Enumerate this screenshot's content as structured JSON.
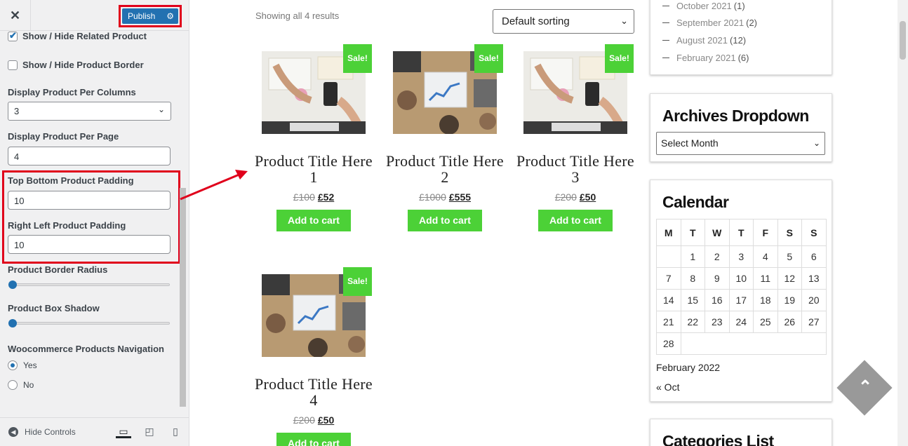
{
  "panel": {
    "close_label": "✕",
    "publish_label": "Publish",
    "show_related_label": "Show / Hide Related Product",
    "show_border_label": "Show / Hide Product Border",
    "per_columns_label": "Display Product Per Columns",
    "per_columns_value": "3",
    "per_page_label": "Display Product Per Page",
    "per_page_value": "4",
    "top_bottom_label": "Top Bottom Product Padding",
    "top_bottom_value": "10",
    "right_left_label": "Right Left Product Padding",
    "right_left_value": "10",
    "border_radius_label": "Product Border Radius",
    "box_shadow_label": "Product Box Shadow",
    "nav_label": "Woocommerce Products Navigation",
    "nav_yes": "Yes",
    "nav_no": "No",
    "hide_controls": "Hide Controls"
  },
  "shop": {
    "results": "Showing all 4 results",
    "sorting": "Default sorting",
    "sale_label": "Sale!",
    "cart_label": "Add to cart",
    "products": [
      {
        "title": "Product Title Here 1",
        "old": "£100",
        "new": "£52"
      },
      {
        "title": "Product Title Here 2",
        "old": "£1000",
        "new": "£555"
      },
      {
        "title": "Product Title Here 3",
        "old": "£200",
        "new": "£50"
      },
      {
        "title": "Product Title Here 4",
        "old": "£200",
        "new": "£50"
      }
    ]
  },
  "sidebar": {
    "archives": [
      {
        "month": "October 2021",
        "count": "(1)"
      },
      {
        "month": "September 2021",
        "count": "(2)"
      },
      {
        "month": "August 2021",
        "count": "(12)"
      },
      {
        "month": "February 2021",
        "count": "(6)"
      }
    ],
    "archives_dropdown_title": "Archives Dropdown",
    "archives_dropdown_value": "Select Month",
    "calendar_title": "Calendar",
    "calendar_days": [
      "M",
      "T",
      "W",
      "T",
      "F",
      "S",
      "S"
    ],
    "calendar_caption": "February 2022",
    "calendar_prev": "« Oct",
    "categories_title": "Categories List"
  },
  "colors": {
    "accent_green": "#4cd137",
    "highlight_red": "#e0001b",
    "wp_blue": "#2271b1"
  }
}
